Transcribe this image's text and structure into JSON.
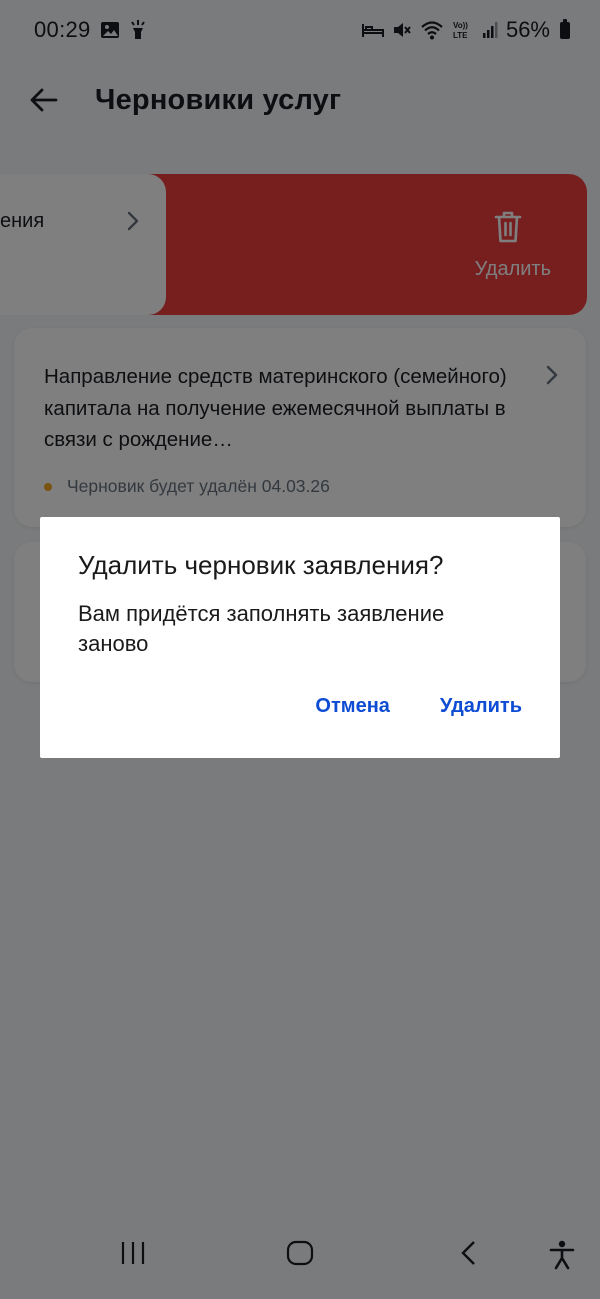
{
  "status_bar": {
    "time": "00:29",
    "battery": "56%",
    "icons": [
      "gallery-icon",
      "flashlight-icon",
      "bed-icon",
      "mute-icon",
      "wifi-icon",
      "volte-icon",
      "signal-icon",
      "battery-icon"
    ]
  },
  "header": {
    "title": "Черновики услуг",
    "back_icon": "arrow-left-icon"
  },
  "swiped_row": {
    "partial_text": "ения",
    "delete_label": "Удалить",
    "delete_icon": "trash-icon"
  },
  "draft": {
    "title": "Направление средств материнского (семейного) капитала на получение ежемесячной выплаты в связи с рождение…",
    "status": "Черновик будет удалён 04.03.26",
    "status_color": "#f5a623"
  },
  "dialog": {
    "title": "Удалить черновик заявления?",
    "message": "Вам придётся заполнять заявление заново",
    "cancel_label": "Отмена",
    "confirm_label": "Удалить",
    "accent_color": "#0d4cd3"
  },
  "nav_bar": {
    "items": [
      "recent-apps-icon",
      "home-icon",
      "back-icon",
      "accessibility-icon"
    ]
  },
  "colors": {
    "delete_action": "#ee3f3f",
    "scrim": "rgba(0,0,0,0.5)"
  }
}
